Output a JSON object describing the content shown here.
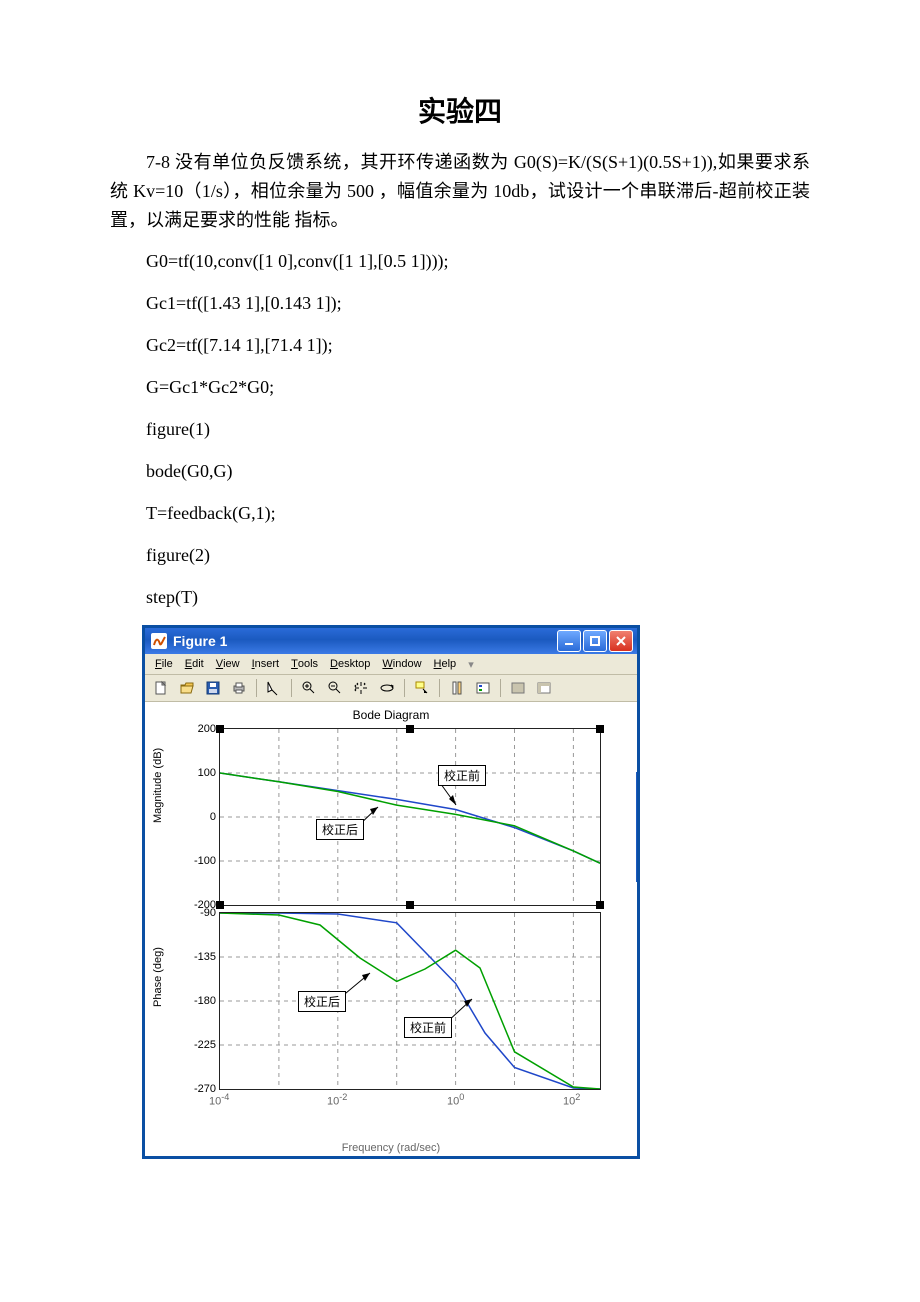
{
  "title": "实验四",
  "problem_text": "7-8 没有单位负反馈系统，其开环传递函数为 G0(S)=K/(S(S+1)(0.5S+1)),如果要求系统 Kv=10（1/s），相位余量为 500 ，幅值余量为 10db，试设计一个串联滞后-超前校正装置，以满足要求的性能 指标。",
  "code": {
    "l1": "G0=tf(10,conv([1 0],conv([1 1],[0.5 1])));",
    "l2": "Gc1=tf([1.43 1],[0.143 1]);",
    "l3": "Gc2=tf([7.14 1],[71.4 1]);",
    "l4": "G=Gc1*Gc2*G0;",
    "l5": "figure(1)",
    "l6": "bode(G0,G)",
    "l7": "T=feedback(G,1);",
    "l8": "figure(2)",
    "l9": "step(T)"
  },
  "figure_window": {
    "title": "Figure 1",
    "menus": [
      {
        "u": "F",
        "rest": "ile"
      },
      {
        "u": "E",
        "rest": "dit"
      },
      {
        "u": "V",
        "rest": "iew"
      },
      {
        "u": "I",
        "rest": "nsert"
      },
      {
        "u": "T",
        "rest": "ools"
      },
      {
        "u": "D",
        "rest": "esktop"
      },
      {
        "u": "W",
        "rest": "indow"
      },
      {
        "u": "H",
        "rest": "elp"
      }
    ],
    "plot_title": "Bode Diagram",
    "mag_label": "Magnitude (dB)",
    "phase_label": "Phase (deg)",
    "x_label": "Frequency  (rad/sec)",
    "mag_ticks": [
      "200",
      "100",
      "0",
      "-100",
      "-200"
    ],
    "ph_ticks": [
      "-90",
      "-135",
      "-180",
      "-225",
      "-270"
    ],
    "x_ticks": [
      "10^{-4}",
      "10^{-2}",
      "10^{0}",
      "10^{2}"
    ],
    "ann_before": "校正前",
    "ann_after": "校正后"
  },
  "chart_data": [
    {
      "type": "line",
      "title": "Bode Diagram — Magnitude",
      "xlabel": "Frequency (rad/sec)",
      "ylabel": "Magnitude (dB)",
      "xscale": "log",
      "xlim": [
        0.0001,
        300
      ],
      "ylim": [
        -200,
        200
      ],
      "x": [
        0.0001,
        0.001,
        0.01,
        0.1,
        1,
        10,
        100,
        300
      ],
      "series": [
        {
          "name": "校正前 (G0)",
          "values": [
            100,
            80,
            60,
            40,
            17,
            -24,
            -77,
            -105
          ]
        },
        {
          "name": "校正后 (G)",
          "values": [
            100,
            80,
            58,
            27,
            6,
            -20,
            -77,
            -105
          ]
        }
      ],
      "annotations": [
        "校正前",
        "校正后"
      ]
    },
    {
      "type": "line",
      "title": "Bode Diagram — Phase",
      "xlabel": "Frequency (rad/sec)",
      "ylabel": "Phase (deg)",
      "xscale": "log",
      "xlim": [
        0.0001,
        300
      ],
      "ylim": [
        -270,
        -90
      ],
      "x": [
        0.0001,
        0.001,
        0.01,
        0.1,
        1,
        10,
        100,
        300
      ],
      "series": [
        {
          "name": "校正前 (G0)",
          "values": [
            -90,
            -90,
            -91,
            -100,
            -162,
            -248,
            -269,
            -270
          ]
        },
        {
          "name": "校正后 (G)",
          "values": [
            -90,
            -92,
            -110,
            -160,
            -128,
            -232,
            -268,
            -270
          ]
        }
      ],
      "annotations": [
        "校正前",
        "校正后"
      ]
    }
  ]
}
